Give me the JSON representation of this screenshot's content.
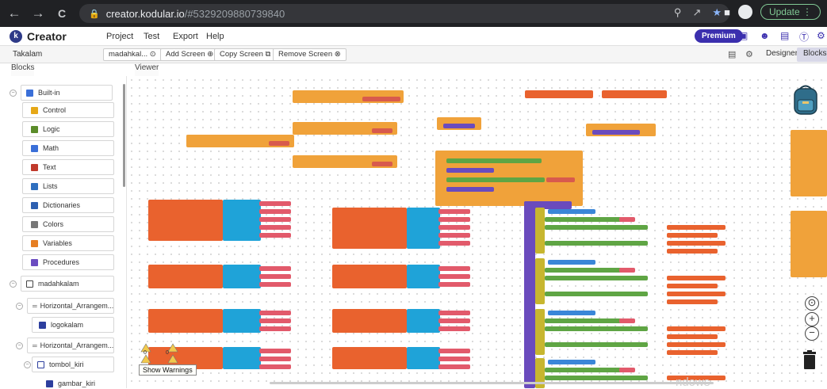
{
  "browser": {
    "url_host": "creator.kodular.io",
    "url_path": "/#5329209880739840",
    "update_label": "Update",
    "nav_back": "←",
    "nav_forward": "→",
    "nav_reload": "C"
  },
  "app": {
    "logo_letter": "k",
    "name": "Creator",
    "menu": [
      "Project",
      "Test",
      "Export",
      "Help"
    ],
    "premium_label": "Premium"
  },
  "toolbar": {
    "project_name": "Takalam",
    "screen_select": "madahkal...",
    "add_screen": "Add Screen",
    "copy_screen": "Copy Screen",
    "remove_screen": "Remove Screen",
    "designer_tab": "Designer",
    "blocks_tab": "Blocks"
  },
  "panels": {
    "blocks_title": "Blocks",
    "viewer_title": "Viewer"
  },
  "sidebar": {
    "builtin_label": "Built-in",
    "builtin_items": [
      {
        "label": "Control",
        "color": "#e6a817"
      },
      {
        "label": "Logic",
        "color": "#5b8c2a"
      },
      {
        "label": "Math",
        "color": "#3a6fd8"
      },
      {
        "label": "Text",
        "color": "#c0392b"
      },
      {
        "label": "Lists",
        "color": "#2f6fbf"
      },
      {
        "label": "Dictionaries",
        "color": "#2d5fb0"
      },
      {
        "label": "Colors",
        "color": "#777777"
      },
      {
        "label": "Variables",
        "color": "#e67e22"
      },
      {
        "label": "Procedures",
        "color": "#6b4cc0"
      }
    ],
    "screen_label": "madahkalam",
    "components": [
      {
        "label": "Horizontal_Arrangem...",
        "level": 1
      },
      {
        "label": "logokalam",
        "level": 2
      },
      {
        "label": "Horizontal_Arrangem...",
        "level": 1
      },
      {
        "label": "tombol_kiri",
        "level": 2
      },
      {
        "label": "gambar_kiri",
        "level": 3
      }
    ]
  },
  "viewer": {
    "warnings_count": "0",
    "errors_count": "0",
    "show_warnings": "Show Warnings",
    "watermark": "ndows"
  },
  "colors": {
    "event_block": "#f0a23a",
    "global_var": "#e9622e",
    "list_block": "#1fa3d8",
    "procedure": "#6a4bbd",
    "text_literal": "#d85a4d",
    "premium": "#3b2fae"
  }
}
